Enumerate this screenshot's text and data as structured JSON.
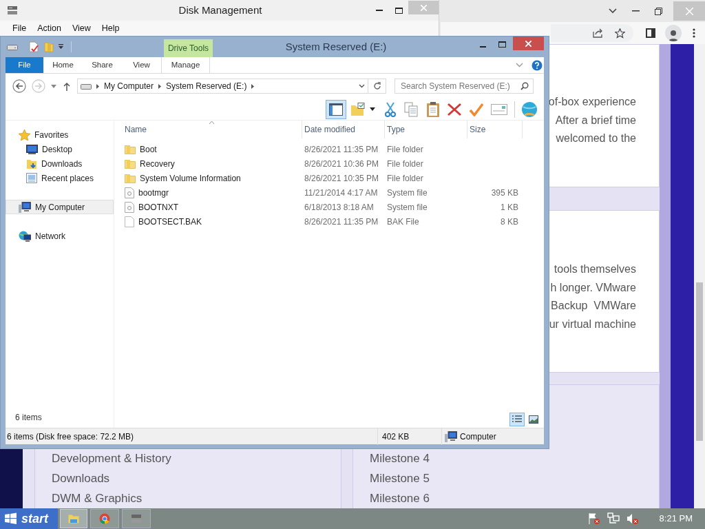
{
  "browser": {
    "cards": [
      {
        "lines": [
          "of-box experience",
          "After a brief time",
          "welcomed to the"
        ]
      },
      {
        "lines": [
          "tools themselves",
          "h longer. VMware",
          "Backup  VMWare",
          "ur virtual machine"
        ]
      }
    ],
    "nav_links": [
      "Development & History",
      "Downloads",
      "DWM & Graphics"
    ],
    "milestones": [
      "Milestone 4",
      "Milestone 5",
      "Milestone 6"
    ]
  },
  "disk_management": {
    "title": "Disk Management",
    "menu": [
      "File",
      "Action",
      "View",
      "Help"
    ]
  },
  "explorer": {
    "title": "System Reserved (E:)",
    "tool_group": "Drive Tools",
    "ribbon_tabs": [
      {
        "label": "File",
        "kind": "backstage"
      },
      {
        "label": "Home",
        "kind": "tab"
      },
      {
        "label": "Share",
        "kind": "tab"
      },
      {
        "label": "View",
        "kind": "tab"
      },
      {
        "label": "Manage",
        "kind": "contextual"
      }
    ],
    "breadcrumb": [
      "My Computer",
      "System Reserved (E:)"
    ],
    "search": {
      "placeholder": "Search System Reserved (E:)"
    },
    "nav": [
      {
        "label": "Favorites",
        "kind": "favorites",
        "selected": false,
        "children": [
          {
            "label": "Desktop",
            "kind": "desktop",
            "selected": false
          },
          {
            "label": "Downloads",
            "kind": "downloads",
            "selected": false
          },
          {
            "label": "Recent places",
            "kind": "recent",
            "selected": false
          }
        ]
      },
      {
        "label": "My Computer",
        "kind": "computer",
        "selected": true
      },
      {
        "label": "Network",
        "kind": "network",
        "selected": false
      }
    ],
    "columns": [
      "Name",
      "Date modified",
      "Type",
      "Size"
    ],
    "files": [
      {
        "name": "Boot",
        "date": "8/26/2021 11:35 PM",
        "type": "File folder",
        "kind": "folder"
      },
      {
        "name": "Recovery",
        "date": "8/26/2021 10:36 PM",
        "type": "File folder",
        "kind": "folder"
      },
      {
        "name": "System Volume Information",
        "date": "8/26/2021 10:35 PM",
        "type": "File folder",
        "kind": "folder"
      },
      {
        "name": "bootmgr",
        "date": "11/21/2014 4:17 AM",
        "type": "System file",
        "size": "395 KB",
        "kind": "system"
      },
      {
        "name": "BOOTNXT",
        "date": "6/18/2013 8:18 AM",
        "type": "System file",
        "size": "1 KB",
        "kind": "system"
      },
      {
        "name": "BOOTSECT.BAK",
        "date": "8/26/2021 11:35 PM",
        "type": "BAK File",
        "size": "8 KB",
        "kind": "file"
      }
    ],
    "item_count": "6 items",
    "view_buttons": [
      {
        "kind": "details",
        "selected": true
      },
      {
        "kind": "large_icons",
        "selected": false
      }
    ],
    "status_bar": {
      "summary": "6 items (Disk free space: 72.2 MB)",
      "size": "402 KB",
      "location": "Computer"
    }
  },
  "taskbar": {
    "start": "start",
    "clock": "8:21 PM"
  }
}
